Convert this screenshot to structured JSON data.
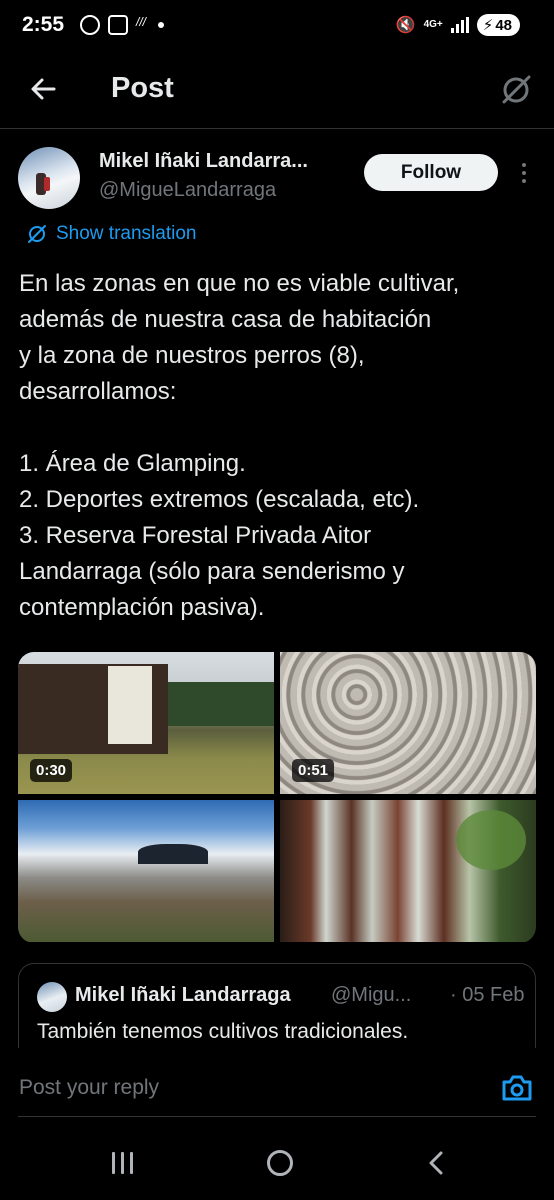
{
  "status_bar": {
    "time": "2:55",
    "network": "4G+",
    "battery": "48"
  },
  "header": {
    "title": "Post"
  },
  "author": {
    "name": "Mikel Iñaki Landarra...",
    "handle": "@MigueLandarraga"
  },
  "follow_label": "Follow",
  "translation_label": "Show translation",
  "post_text": "En las zonas en que no es viable cultivar,\nademás de nuestra casa de habitación\ny la zona de nuestros perros (8),\ndesarrollamos:\n\n1. Área de Glamping.\n2. Deportes extremos (escalada, etc).\n3. Reserva Forestal Privada Aitor\nLandarraga (sólo para senderismo y\ncontemplación pasiva).",
  "media": [
    {
      "kind": "video",
      "duration": "0:30",
      "subject": "glamping deck"
    },
    {
      "kind": "video",
      "duration": "0:51",
      "subject": "gravel"
    },
    {
      "kind": "photo",
      "subject": "mountain valley"
    },
    {
      "kind": "photo",
      "subject": "forest trees"
    }
  ],
  "quote": {
    "name": "Mikel Iñaki Landarraga",
    "handle": "@Migu...",
    "date": "· 05 Feb",
    "text": "También tenemos cultivos tradicionales."
  },
  "reply": {
    "placeholder": "Post your reply"
  },
  "colors": {
    "accent": "#1d9bf0",
    "background": "#000000",
    "text": "#e7e9ea",
    "muted": "#71767b"
  },
  "icons": [
    "back-arrow-icon",
    "grok-icon",
    "more-icon",
    "translate-icon",
    "camera-icon"
  ]
}
